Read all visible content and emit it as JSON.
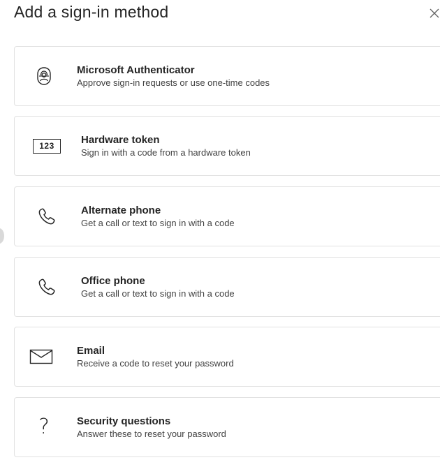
{
  "dialog": {
    "title": "Add a sign-in method",
    "close_icon": "close-icon"
  },
  "methods": [
    {
      "name": "Microsoft Authenticator",
      "description": "Approve sign-in requests or use one-time codes",
      "icon": "authenticator-icon"
    },
    {
      "name": "Hardware token",
      "description": "Sign in with a code from a hardware token",
      "icon": "hardware-token-icon",
      "icon_text": "123"
    },
    {
      "name": "Alternate phone",
      "description": "Get a call or text to sign in with a code",
      "icon": "phone-icon"
    },
    {
      "name": "Office phone",
      "description": "Get a call or text to sign in with a code",
      "icon": "phone-icon"
    },
    {
      "name": "Email",
      "description": "Receive a code to reset your password",
      "icon": "mail-icon"
    },
    {
      "name": "Security questions",
      "description": "Answer these to reset your password",
      "icon": "question-icon",
      "icon_text": "?"
    }
  ]
}
